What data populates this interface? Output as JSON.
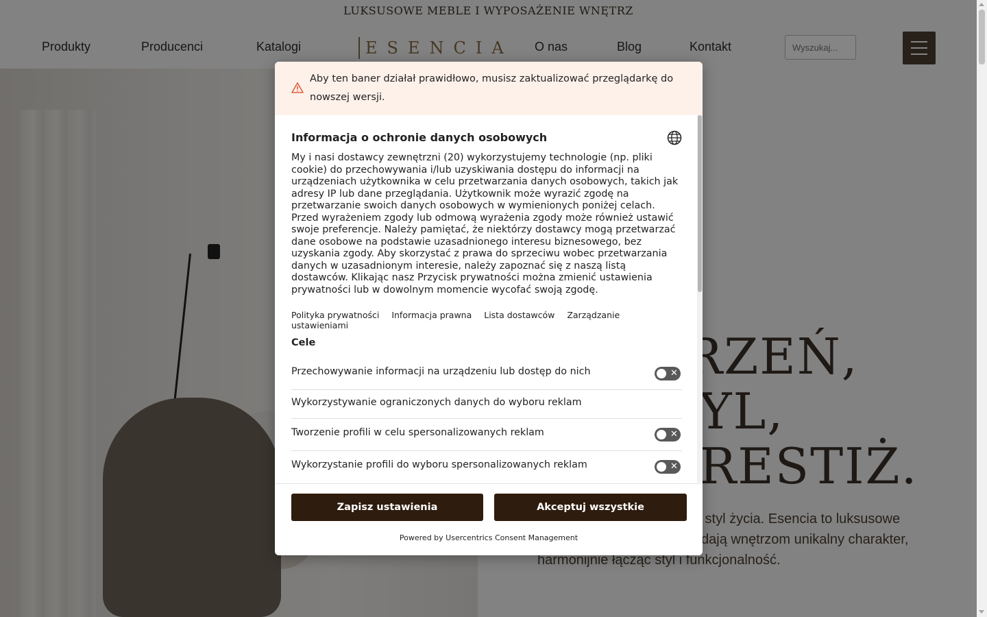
{
  "site": {
    "tagline": "LUKSUSOWE MEBLE I WYPOSAŻENIE WNĘTRZ",
    "nav": {
      "products": "Produkty",
      "producers": "Producenci",
      "catalogs": "Katalogi",
      "logo": "ESENCIA",
      "about": "O nas",
      "blog": "Blog",
      "contact": "Kontakt"
    },
    "search_placeholder": "Wyszukaj...",
    "hero": {
      "heading_lines": [
        "RZEŃ,",
        "YL,",
        "RESTIŻ."
      ],
      "text": "które w pełni odzwierciedla styl życia. Esencia to luksusowe meble i akcesoria, które nadają wnętrzom unikalny charakter, harmonijnie łącząc styl i funkcjonalność."
    },
    "colors": {
      "brand_gold": "#8a6c45",
      "button_dark": "#2e1c0e",
      "overlay": "rgba(0,0,0,0.48)"
    }
  },
  "consent": {
    "warning_text": "Aby ten baner działał prawidłowo, musisz zaktualizować przeglądarkę do nowszej wersji.",
    "title": "Informacja o ochronie danych osobowych",
    "description": "My i nasi dostawcy zewnętrzni (20) wykorzystujemy technologie (np. pliki cookie) do przechowywania i/lub uzyskiwania dostępu do informacji na urządzeniach użytkownika w celu przetwarzania danych osobowych, takich jak adresy IP lub dane przeglądania. Użytkownik może wyrazić zgodę na przetwarzanie swoich danych osobowych w wymienionych poniżej celach. Przed wyrażeniem zgody lub odmową wyrażenia zgody może również ustawić swoje preferencje. Należy pamiętać, że niektórzy dostawcy mogą przetwarzać dane osobowe na podstawie uzasadnionego interesu biznesowego, bez uzyskania zgody. Aby skorzystać z prawa do sprzeciwu wobec przetwarzania danych w uzasadnionym interesie, należy zapoznać się z naszą listą dostawców. Klikając nasz Przycisk prywatności można zmienić ustawienia prywatności lub w dowolnym momencie wycofać swoją zgodę.",
    "links": {
      "privacy": "Polityka prywatności",
      "legal": "Informacja prawna",
      "vendors": "Lista dostawców",
      "settings": "Zarządzanie ustawieniami"
    },
    "purposes_heading": "Cele",
    "purposes": [
      {
        "label": "Przechowywanie informacji na urządzeniu lub dostęp do nich",
        "toggle": false
      },
      {
        "label": "Wykorzystywanie ograniczonych danych do wyboru reklam"
      },
      {
        "label": "Tworzenie profili w celu spersonalizowanych reklam",
        "toggle": false
      },
      {
        "label": "Wykorzystanie profili do wyboru spersonalizowanych reklam",
        "toggle": false
      }
    ],
    "save_button": "Zapisz ustawienia",
    "accept_button": "Akceptuj wszystkie",
    "powered_by": "Powered by Usercentrics Consent Management"
  }
}
